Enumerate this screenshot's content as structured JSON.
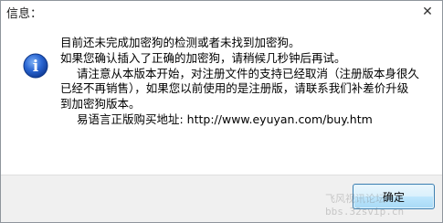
{
  "window": {
    "title": "信息：",
    "close_glyph": "✕"
  },
  "icon": {
    "name": "info-icon",
    "glyph": "i",
    "color": "#1c56c6"
  },
  "message": {
    "lines": [
      "目前还未完成加密狗的检测或者未找到加密狗。",
      "如果您确认插入了正确的加密狗，请稍候几秒钟后再试。",
      "请注意从本版本开始，对注册文件的支持已经取消（注册版本身很久",
      "已经不再销售），如果您以前使用的是注册版，请联系我们补差价升级",
      "到加密狗版本。",
      "易语言正版购买地址: http://www.eyuyan.com/buy.htm"
    ]
  },
  "buttons": {
    "ok_label": "确定"
  },
  "watermark": {
    "line1": "飞风视讯论坛",
    "line2": "bbs.32svip.cn"
  }
}
